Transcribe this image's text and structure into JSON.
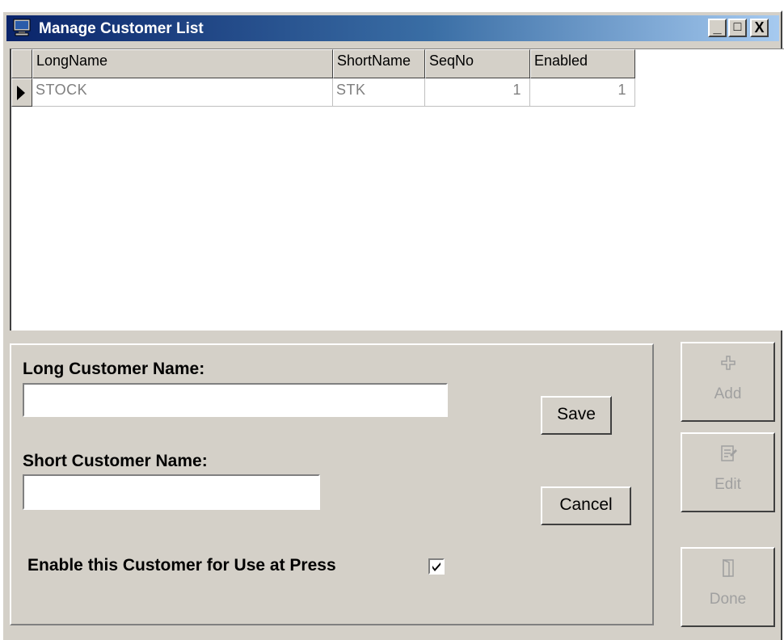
{
  "window": {
    "title": "Manage Customer List",
    "controls": {
      "minimize": "_",
      "maximize": "□",
      "close": "X"
    }
  },
  "grid": {
    "columns": [
      "LongName",
      "ShortName",
      "SeqNo",
      "Enabled"
    ],
    "rows": [
      {
        "LongName": "STOCK",
        "ShortName": "STK",
        "SeqNo": "1",
        "Enabled": "1"
      }
    ]
  },
  "form": {
    "long_name_label": "Long Customer Name:",
    "long_name_value": "",
    "short_name_label": "Short Customer Name:",
    "short_name_value": "",
    "enable_label": "Enable this Customer for Use at Press",
    "enable_checked": true,
    "save_label": "Save",
    "cancel_label": "Cancel"
  },
  "side_buttons": {
    "add": {
      "label": "Add",
      "icon": "plus-icon"
    },
    "edit": {
      "label": "Edit",
      "icon": "edit-document-icon"
    },
    "done": {
      "label": "Done",
      "icon": "door-icon"
    }
  },
  "colors": {
    "title_gradient_start": "#0a246a",
    "title_gradient_end": "#a6caf0",
    "face": "#d4d0c8",
    "disabled_text": "#a0a0a0"
  }
}
